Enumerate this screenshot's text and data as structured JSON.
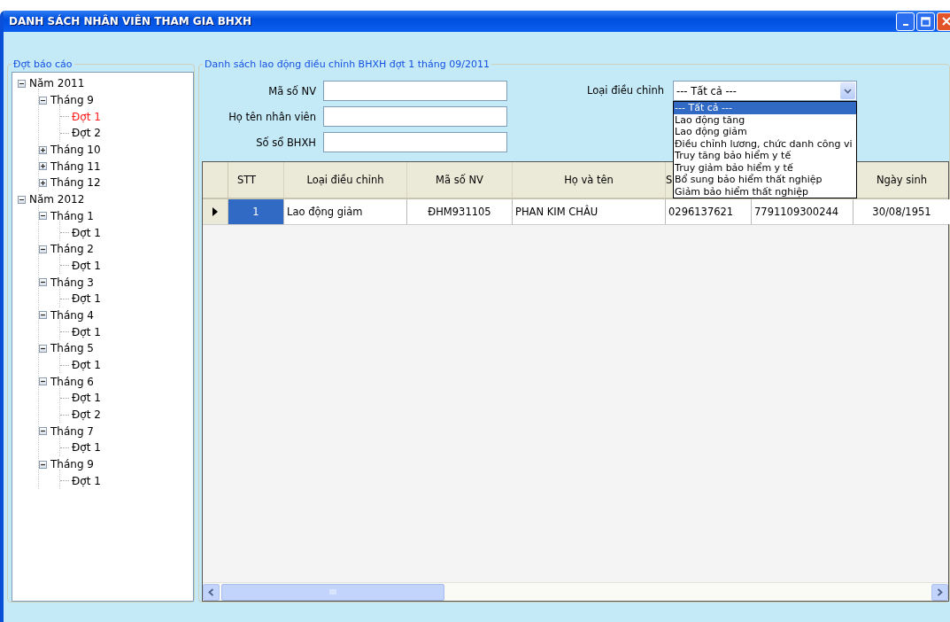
{
  "window": {
    "title": "DANH SÁCH NHÂN VIÊN THAM GIA BHXH"
  },
  "left_panel": {
    "title": "Đợt báo cáo",
    "tree": [
      {
        "label": "Năm 2011",
        "expanded": true,
        "selected": false,
        "children": [
          {
            "label": "Tháng 9",
            "expanded": true,
            "selected": false,
            "children": [
              {
                "label": "Đợt 1",
                "selected": true
              },
              {
                "label": "Đợt 2",
                "selected": false
              }
            ]
          },
          {
            "label": "Tháng 10",
            "expanded": false,
            "selected": false
          },
          {
            "label": "Tháng 11",
            "expanded": false,
            "selected": false
          },
          {
            "label": "Tháng 12",
            "expanded": false,
            "selected": false
          }
        ]
      },
      {
        "label": "Năm 2012",
        "expanded": true,
        "selected": false,
        "children": [
          {
            "label": "Tháng 1",
            "expanded": true,
            "selected": false,
            "children": [
              {
                "label": "Đợt 1",
                "selected": false
              }
            ]
          },
          {
            "label": "Tháng 2",
            "expanded": true,
            "selected": false,
            "children": [
              {
                "label": "Đợt 1",
                "selected": false
              }
            ]
          },
          {
            "label": "Tháng 3",
            "expanded": true,
            "selected": false,
            "children": [
              {
                "label": "Đợt 1",
                "selected": false
              }
            ]
          },
          {
            "label": "Tháng 4",
            "expanded": true,
            "selected": false,
            "children": [
              {
                "label": "Đợt 1",
                "selected": false
              }
            ]
          },
          {
            "label": "Tháng 5",
            "expanded": true,
            "selected": false,
            "children": [
              {
                "label": "Đợt 1",
                "selected": false
              }
            ]
          },
          {
            "label": "Tháng 6",
            "expanded": true,
            "selected": false,
            "children": [
              {
                "label": "Đợt 1",
                "selected": false
              },
              {
                "label": "Đợt 2",
                "selected": false
              }
            ]
          },
          {
            "label": "Tháng 7",
            "expanded": true,
            "selected": false,
            "children": [
              {
                "label": "Đợt 1",
                "selected": false
              }
            ]
          },
          {
            "label": "Tháng 9",
            "expanded": true,
            "selected": false,
            "children": [
              {
                "label": "Đợt 1",
                "selected": false
              }
            ]
          }
        ]
      }
    ]
  },
  "right_panel": {
    "title": "Danh sách lao động điều chỉnh BHXH đợt 1 tháng 09/2011",
    "fields": [
      {
        "label": "Mã số NV"
      },
      {
        "label": "Họ tên nhân viên"
      },
      {
        "label": "Số sổ BHXH"
      }
    ],
    "filter": {
      "label": "Loại điều chỉnh",
      "value": "--- Tất cả ---",
      "expanded": true,
      "options": [
        {
          "label": "--- Tất cả ---",
          "selected": true
        },
        {
          "label": "Lao động tăng",
          "selected": false
        },
        {
          "label": "Lao động giảm",
          "selected": false
        },
        {
          "label": "Điều chỉnh lương, chức danh công vi",
          "selected": false
        },
        {
          "label": "Truy tăng bảo hiểm y tế",
          "selected": false
        },
        {
          "label": "Truy giảm bảo hiểm y tế",
          "selected": false
        },
        {
          "label": "Bổ sung bảo hiểm thất nghiệp",
          "selected": false
        },
        {
          "label": "Giảm bảo hiểm thất nghiệp",
          "selected": false
        }
      ]
    },
    "table": {
      "columns": [
        {
          "label": "STT"
        },
        {
          "label": "Loại điều chỉnh"
        },
        {
          "label": "Mã số NV"
        },
        {
          "label": "Họ và tên"
        },
        {
          "label": "S"
        },
        {},
        {
          "label": "Ngày sinh"
        }
      ],
      "rows": [
        {
          "selected": true,
          "cells": [
            "1",
            "Lao động giảm",
            "ĐHM931105",
            "PHAN KIM CHÂU",
            "0296137621",
            "7791109300244",
            "30/08/1951"
          ]
        }
      ]
    }
  }
}
